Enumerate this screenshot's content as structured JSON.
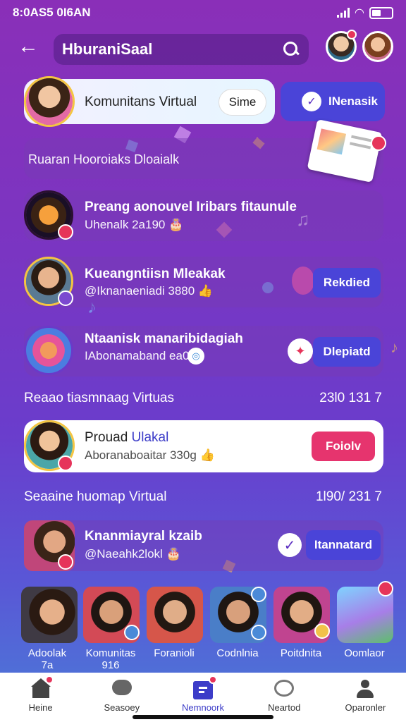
{
  "status": {
    "time": "8:0AS5 0I6AN"
  },
  "header": {
    "title": "HburaniSaal"
  },
  "featured": {
    "title": "Komunitans Virtual",
    "pill": "Sime",
    "action": "INenasik",
    "banner": "Ruaran Hooroiaks Dloaialk"
  },
  "items": [
    {
      "title": "Preang aonouvel Iribars fitaunule",
      "sub": "Uhenalk 2a190 🎂"
    },
    {
      "title": "Kueangntiisn Mleakak",
      "sub": "@Iknanaeniadi 3880 👍",
      "action": "Rekdied"
    },
    {
      "title": "Ntaanisk manaribidagiah",
      "sub": "IAbonamaband ea0i",
      "action": "Dlepiatd"
    }
  ],
  "section1": {
    "label": "Reaao tiasmnaag Virtuas",
    "count": "23l0 131 7"
  },
  "highlight": {
    "title_a": "Prouad ",
    "title_b": "Ulakal",
    "sub": "Aboranaboaitar 330g 👍",
    "action": "Foiolv"
  },
  "section2": {
    "label": "Seaaine huomap Virtual",
    "count": "1l90/ 231 7"
  },
  "friend": {
    "title": "Knanmiayral kzaib",
    "sub": "@Naeahk2lokl 🎂",
    "action": "Itannatard"
  },
  "people": [
    {
      "label": "Adoolak",
      "sub": "7a"
    },
    {
      "label": "Komunitas",
      "sub": "916"
    },
    {
      "label": "Foranioli",
      "sub": ""
    },
    {
      "label": "Codnlnia",
      "sub": ""
    },
    {
      "label": "Poitdnita",
      "sub": ""
    },
    {
      "label": "Oomlaor",
      "sub": ""
    }
  ],
  "nav": [
    {
      "label": "Heine"
    },
    {
      "label": "Seasoey"
    },
    {
      "label": "Nemnoork"
    },
    {
      "label": "Neartod"
    },
    {
      "label": "Oparonler"
    }
  ],
  "colors": {
    "accent": "#4a44d8",
    "pink": "#e6346e",
    "badge": "#e6345a"
  }
}
